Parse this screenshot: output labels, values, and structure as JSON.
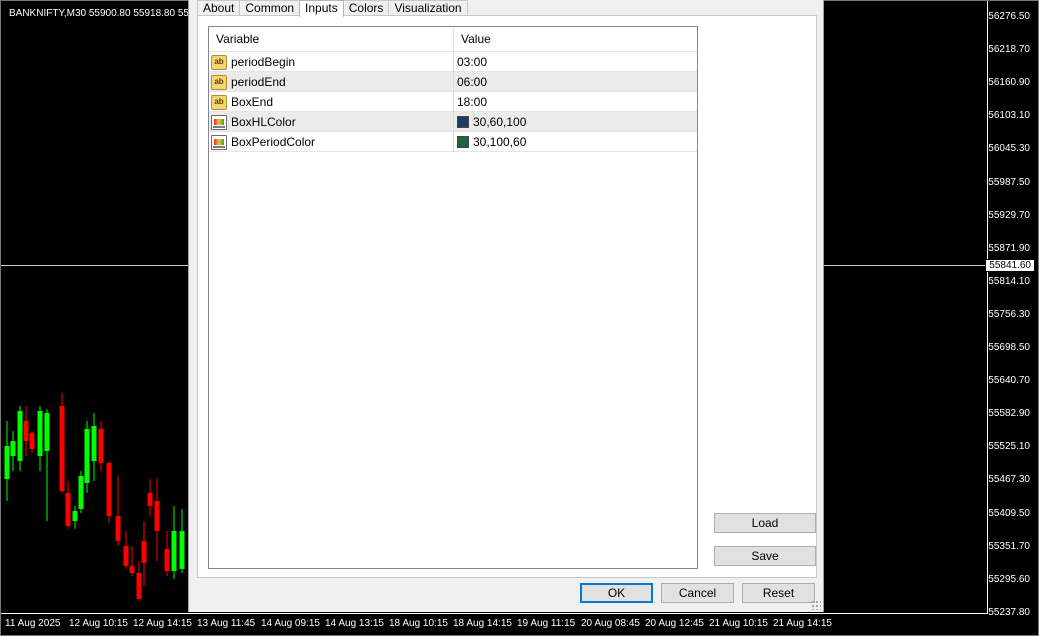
{
  "chart": {
    "symbol_line": "BANKNIFTY,M30  55900.80 55918.80 558",
    "current_price": "55841.60",
    "price_labels": [
      "56276.50",
      "56218.70",
      "56160.90",
      "56103.10",
      "56045.30",
      "55987.50",
      "55929.70",
      "55871.90",
      "55814.10",
      "55756.30",
      "55698.50",
      "55640.70",
      "55582.90",
      "55525.10",
      "55467.30",
      "55409.50",
      "55351.70",
      "55295.60",
      "55237.80"
    ],
    "time_labels": [
      "11 Aug 2025",
      "12 Aug 10:15",
      "12 Aug 14:15",
      "13 Aug 11:45",
      "14 Aug 09:15",
      "14 Aug 13:15",
      "18 Aug 10:15",
      "18 Aug 14:15",
      "19 Aug 11:15",
      "20 Aug 08:45",
      "20 Aug 12:45",
      "21 Aug 10:15",
      "21 Aug 14:15"
    ],
    "colors": {
      "bull": "#00ff00",
      "bear": "#ff0000",
      "background": "#000000"
    }
  },
  "dialog": {
    "tabs": [
      {
        "label": "About",
        "active": false
      },
      {
        "label": "Common",
        "active": false
      },
      {
        "label": "Inputs",
        "active": true
      },
      {
        "label": "Colors",
        "active": false
      },
      {
        "label": "Visualization",
        "active": false
      }
    ],
    "grid": {
      "columns": [
        "Variable",
        "Value"
      ],
      "rows": [
        {
          "variable": "periodBegin",
          "value": "03:00",
          "icon": "string-ab-icon"
        },
        {
          "variable": "periodEnd",
          "value": "06:00",
          "icon": "string-ab-icon"
        },
        {
          "variable": "BoxEnd",
          "value": "18:00",
          "icon": "string-ab-icon"
        },
        {
          "variable": "BoxHLColor",
          "value": "30,60,100",
          "icon": "color-icon",
          "swatch": "#1e3c64"
        },
        {
          "variable": "BoxPeriodColor",
          "value": "30,100,60",
          "icon": "color-icon",
          "swatch": "#1e643c"
        }
      ]
    },
    "buttons": {
      "load": "Load",
      "save": "Save",
      "ok": "OK",
      "cancel": "Cancel",
      "reset": "Reset"
    }
  }
}
